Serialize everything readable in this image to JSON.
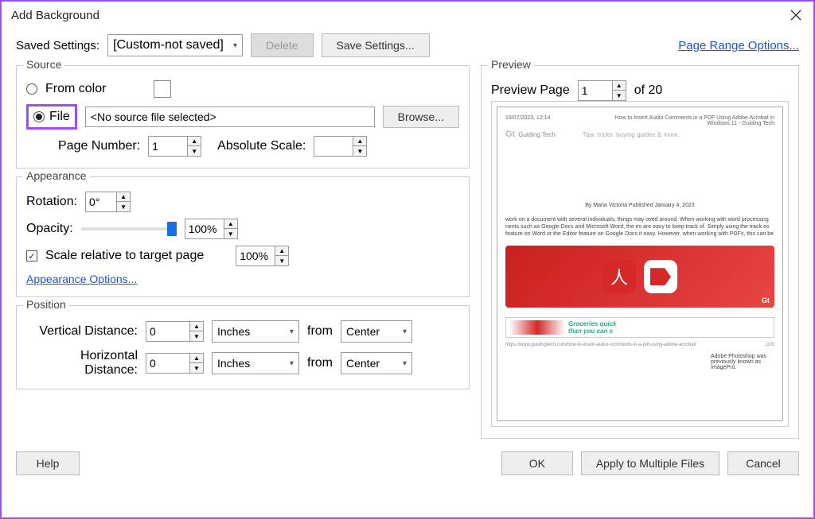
{
  "title": "Add Background",
  "saved_settings": {
    "label": "Saved Settings:",
    "value": "[Custom-not saved]"
  },
  "buttons": {
    "delete": "Delete",
    "save_settings": "Save Settings...",
    "browse": "Browse...",
    "help": "Help",
    "ok": "OK",
    "apply_multiple": "Apply to Multiple Files",
    "cancel": "Cancel"
  },
  "page_range_link": "Page Range Options...",
  "source": {
    "title": "Source",
    "from_color": "From color",
    "file": "File",
    "file_value": "<No source file selected>",
    "page_number_label": "Page Number:",
    "page_number_value": "1",
    "absolute_scale_label": "Absolute Scale:",
    "absolute_scale_value": ""
  },
  "appearance": {
    "title": "Appearance",
    "rotation_label": "Rotation:",
    "rotation_value": "0°",
    "opacity_label": "Opacity:",
    "opacity_value": "100%",
    "scale_relative_label": "Scale relative to target page",
    "scale_relative_value": "100%",
    "options_link": "Appearance Options..."
  },
  "position": {
    "title": "Position",
    "vertical_label": "Vertical Distance:",
    "horizontal_label": "Horizontal Distance:",
    "value": "0",
    "unit": "Inches",
    "from_label": "from",
    "from_value": "Center"
  },
  "preview": {
    "title": "Preview",
    "page_label": "Preview Page",
    "page_value": "1",
    "total": "of 20",
    "doc_time": "19/07/2023, 12:14",
    "doc_title": "How to Insert Audio Comments in a PDF Using Adobe Acrobat in Windows 11 - Guiding Tech",
    "doc_logo": "Guiding Tech",
    "doc_tagline": "Tips. tricks. buying guides & more.",
    "doc_byline": "By Maria Victoria  Published January 4, 2023",
    "doc_para": "work on a document with several individuals, things may oved around. When working with word processing nents such as Google Docs and Microsoft Word, the es are easy to keep track of. Simply using the track es feature on Word or the Editor feature on Google Docs it easy. However, when working with PDFs, this can be",
    "side_note": "Adobe Photoshop was previously known as ImagePro.",
    "ad_text": "Groceries quick\nthan you can s",
    "footer_url": "https://www.guidingtech.com/how-to-insert-audio-comments-in-a-pdf-using-adobe-acrobat/",
    "footer_page": "1/20"
  }
}
